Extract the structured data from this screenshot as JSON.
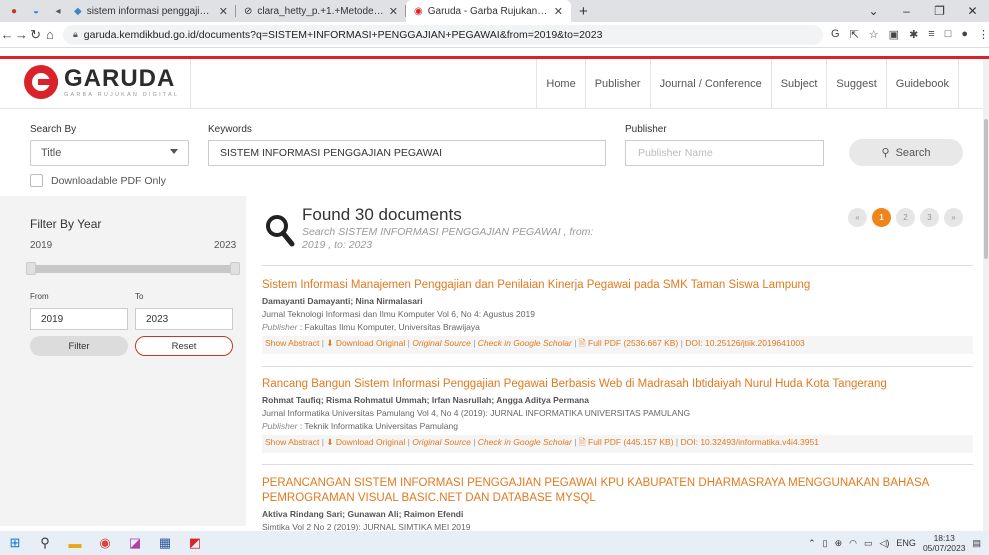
{
  "browser": {
    "tabs": [
      {
        "label": "sistem informasi penggajian pegawai",
        "active": false
      },
      {
        "label": "clara_hetty_p.+1.+Metode+Syste",
        "active": false
      },
      {
        "label": "Garuda - Garba Rujukan Digital",
        "active": true
      }
    ],
    "url": "garuda.kemdikbud.go.id/documents?q=SISTEM+INFORMASI+PENGGAJIAN+PEGAWAI&from=2019&to=2023"
  },
  "site": {
    "logo_name": "GARUDA",
    "logo_sub": "GARBA RUJUKAN DIGITAL",
    "brand_color": "#d9222a",
    "accent_color": "#e07a1f",
    "nav": [
      "Home",
      "Publisher",
      "Journal / Conference",
      "Subject",
      "Suggest",
      "Guidebook"
    ]
  },
  "search": {
    "search_by_label": "Search By",
    "search_by_value": "Title",
    "keywords_label": "Keywords",
    "keywords_value": "SISTEM INFORMASI PENGGAJIAN PEGAWAI",
    "publisher_label": "Publisher",
    "publisher_placeholder": "Publisher Name",
    "search_button": "Search",
    "pdf_only_label": "Downloadable PDF Only"
  },
  "filter": {
    "title": "Filter By Year",
    "min_year": "2019",
    "max_year": "2023",
    "from_label": "From",
    "to_label": "To",
    "from_value": "2019",
    "to_value": "2023",
    "filter_button": "Filter",
    "reset_button": "Reset"
  },
  "results": {
    "found": "Found 30 documents",
    "subtitle_prefix": "Search ",
    "subtitle_query": "SISTEM INFORMASI PENGGAJIAN PEGAWAI",
    "subtitle_suffix": " , from: 2019 , to: 2023",
    "pages": [
      "«",
      "1",
      "2",
      "3",
      "»"
    ],
    "current_page": "1",
    "items": [
      {
        "title": "Sistem Informasi Manajemen Penggajian dan Penilaian Kinerja Pegawai pada SMK Taman Siswa Lampung",
        "authors": "Damayanti Damayanti; Nina Nirmalasari",
        "journal": "Jurnal Teknologi Informasi dan Ilmu Komputer Vol 6, No 4: Agustus 2019",
        "publisher_label": "Publisher",
        "publisher": ": Fakultas Ilmu Komputer, Universitas Brawijaya",
        "show_abstract": "Show Abstract",
        "download": "Download Original",
        "original_source": "Original Source",
        "scholar": "Check in Google Scholar",
        "fullpdf": "Full PDF (2536.667 KB)",
        "doi": "DOI: 10.25126/jtiik.2019641003"
      },
      {
        "title": "Rancang Bangun Sistem Informasi Penggajian Pegawai Berbasis Web di Madrasah Ibtidaiyah Nurul Huda Kota Tangerang",
        "authors": "Rohmat Taufiq; Risma Rohmatul Ummah; Irfan Nasrullah; Angga Aditya Permana",
        "journal": "Jurnal Informatika Universitas Pamulang Vol 4, No 4 (2019): JURNAL INFORMATIKA UNIVERSITAS PAMULANG",
        "publisher_label": "Publisher",
        "publisher": ": Teknik Informatika Universitas Pamulang",
        "show_abstract": "Show Abstract",
        "download": "Download Original",
        "original_source": "Original Source",
        "scholar": "Check in Google Scholar",
        "fullpdf": "Full PDF (445.157 KB)",
        "doi": "DOI: 10.32493/informatika.v4i4.3951"
      },
      {
        "title": "PERANCANGAN SISTEM INFORMASI PENGGAJIAN PEGAWAI KPU KABUPATEN DHARMASRAYA MENGGUNAKAN BAHASA PEMROGRAMAN VISUAL BASIC.NET DAN DATABASE MYSQL",
        "authors": "Aktiva Rindang Sari; Gunawan Ali; Raimon Efendi",
        "journal": "Simtika Vol 2 No 2 (2019): JURNAL SIMTIKA MEI 2019"
      }
    ]
  },
  "taskbar": {
    "lang": "ENG",
    "time": "18:13",
    "date": "05/07/2023"
  }
}
